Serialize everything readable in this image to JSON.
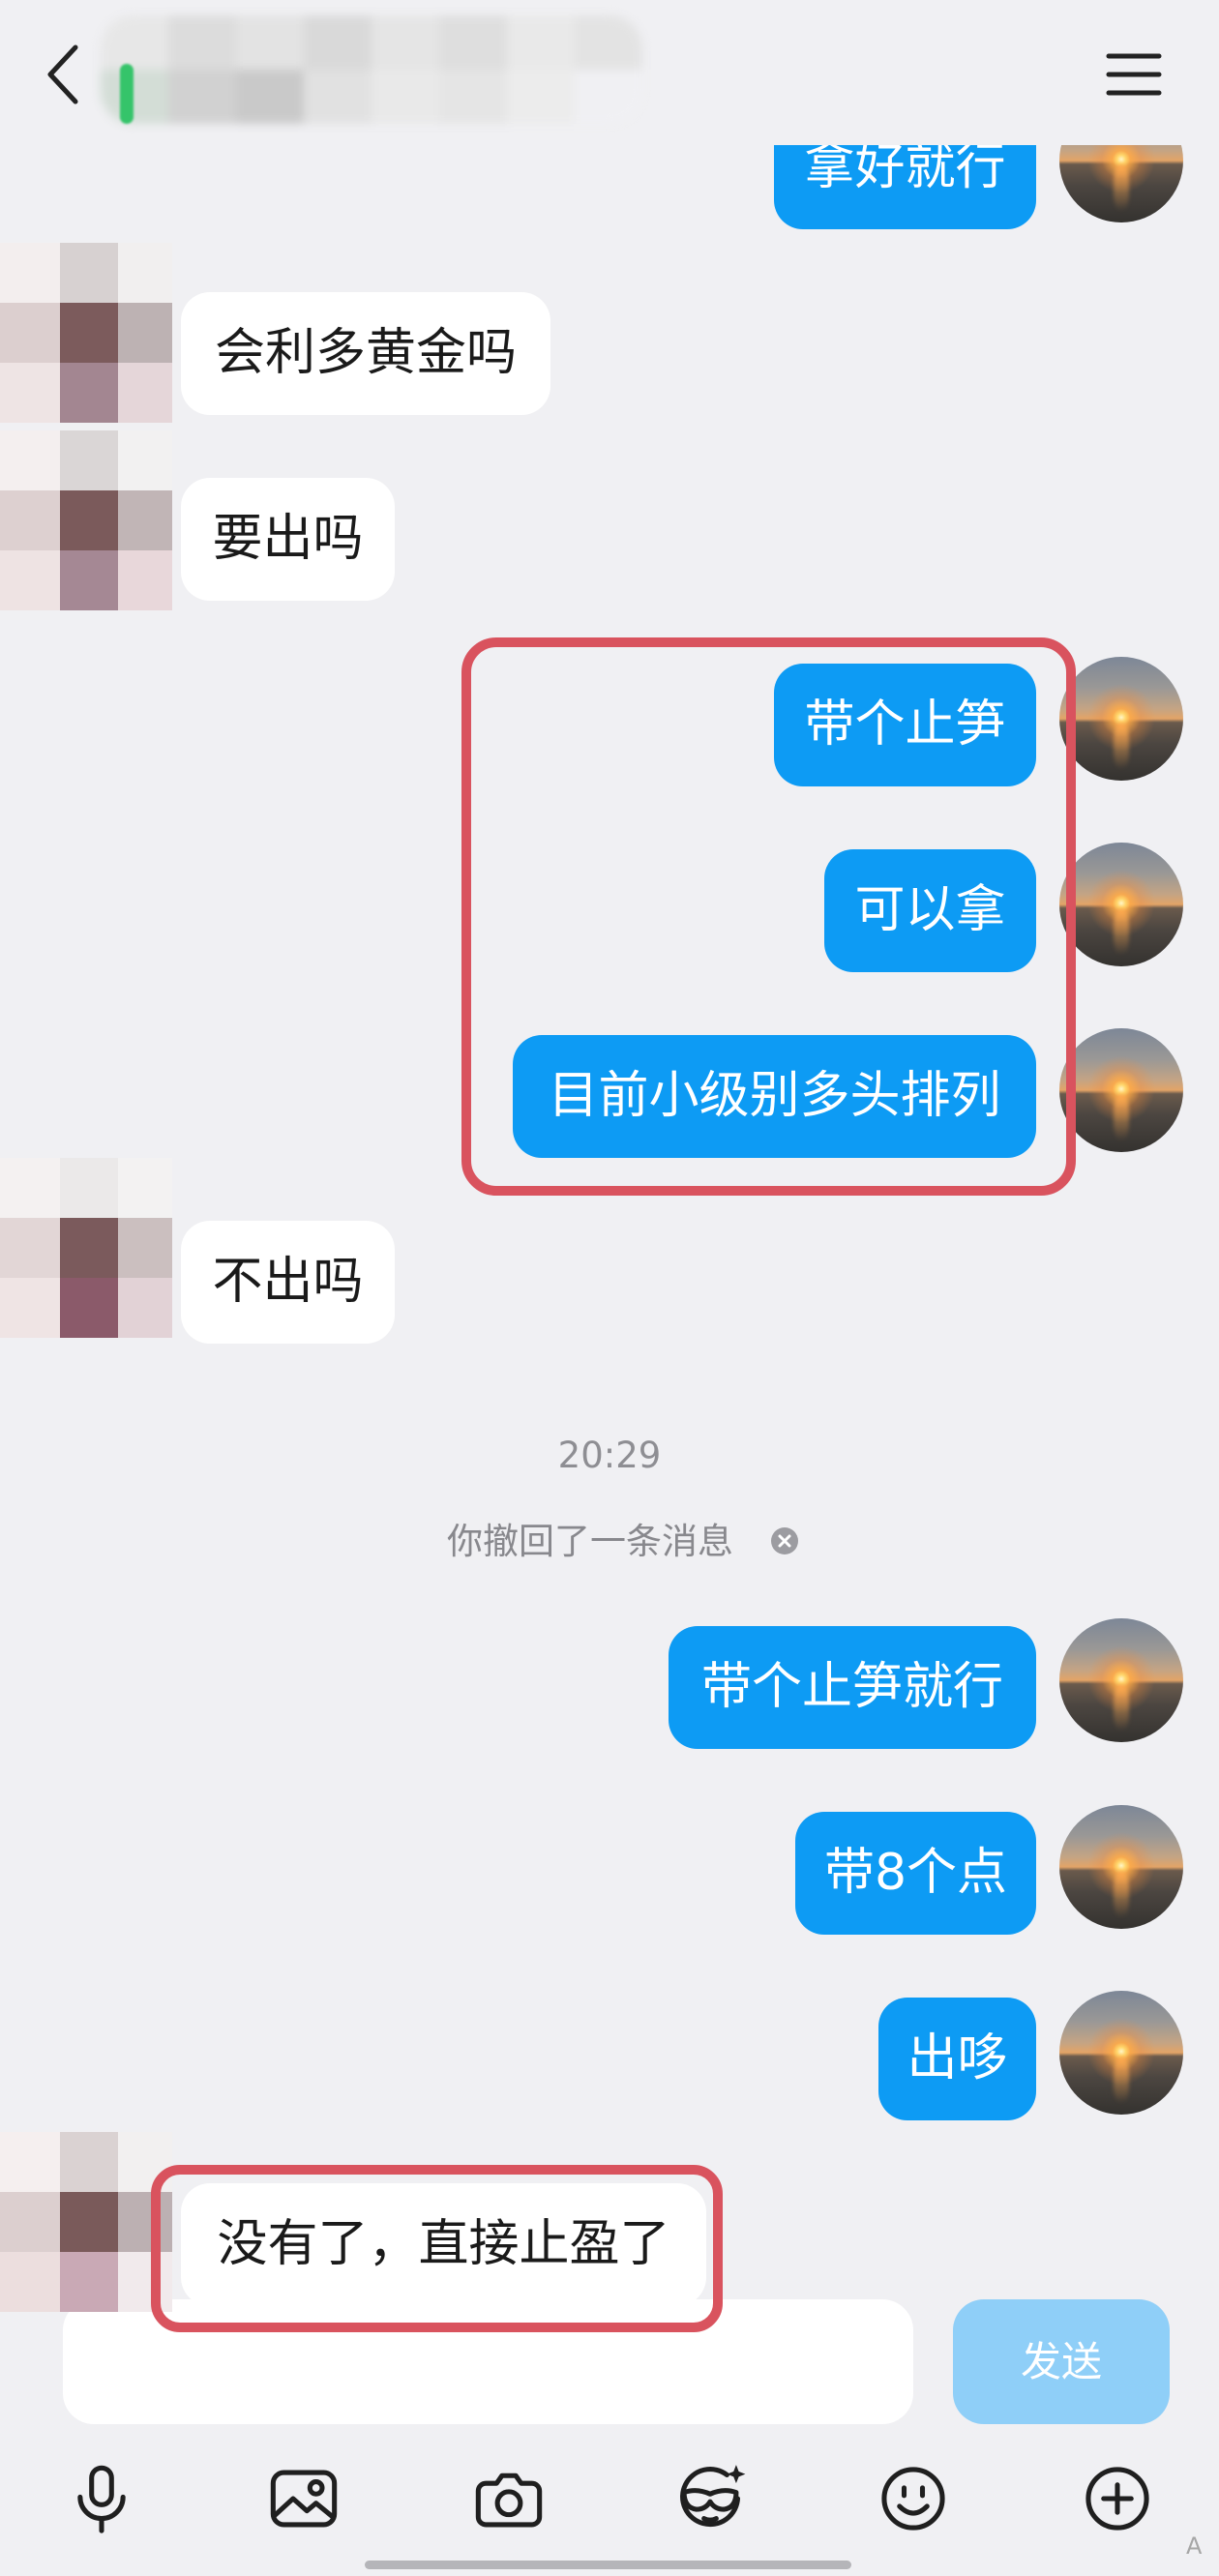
{
  "header": {
    "back_icon": "back-arrow-icon",
    "menu_icon": "menu-icon"
  },
  "messages": [
    {
      "outgoing": true,
      "highlighted": false,
      "text": "拿好就行"
    },
    {
      "outgoing": false,
      "highlighted": false,
      "text": "会利多黄金吗"
    },
    {
      "outgoing": false,
      "highlighted": false,
      "text": "要出吗"
    },
    {
      "outgoing": true,
      "highlighted": true,
      "text": "带个止笋"
    },
    {
      "outgoing": true,
      "highlighted": true,
      "text": "可以拿"
    },
    {
      "outgoing": true,
      "highlighted": true,
      "text": "目前小级别多头排列"
    },
    {
      "outgoing": false,
      "highlighted": false,
      "text": "不出吗"
    },
    {
      "outgoing": true,
      "highlighted": false,
      "text": "带个止笋就行"
    },
    {
      "outgoing": true,
      "highlighted": false,
      "text": "带8个点"
    },
    {
      "outgoing": true,
      "highlighted": false,
      "text": "出哆"
    },
    {
      "outgoing": false,
      "highlighted": true,
      "text": "没有了，直接止盈了"
    }
  ],
  "time_divider": "20:29",
  "recall_notice": {
    "text": "你撤回了一条消息",
    "icon": "close-circle-icon"
  },
  "input": {
    "value": "",
    "placeholder": ""
  },
  "send_button": {
    "label": "发送"
  },
  "toolbar": {
    "icons": [
      "microphone-icon",
      "image-icon",
      "camera-icon",
      "mask-sparkle-icon",
      "emoji-icon",
      "plus-circle-icon"
    ]
  },
  "corner_mark": "A",
  "colors": {
    "background": "#f0f0f3",
    "outgoing_bubble": "#0d9bf4",
    "incoming_bubble": "#ffffff",
    "annotation": "#d9535e",
    "send_button": "#8fcff8",
    "online_indicator": "#35c46a"
  }
}
